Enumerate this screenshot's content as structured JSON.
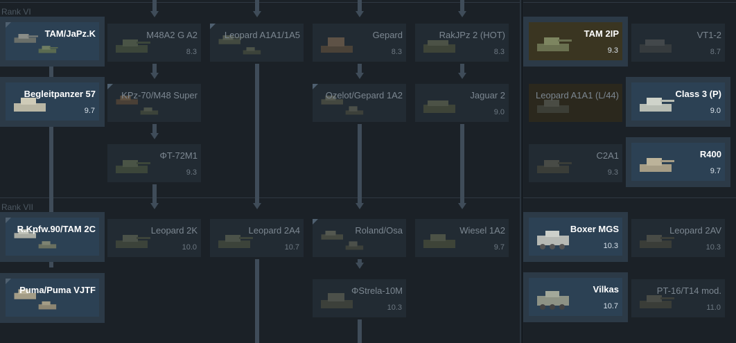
{
  "ranks": {
    "rank6": "Rank VI",
    "rank7": "Rank VII"
  },
  "vehicles": {
    "tam_japz": {
      "name": "TAM/JaPz.K",
      "br": ""
    },
    "m48a2g": {
      "name": "M48A2 G A2",
      "br": "8.3"
    },
    "leopard_a1a1_1a5": {
      "name": "Leopard A1A1/1A5",
      "br": ""
    },
    "gepard": {
      "name": "Gepard",
      "br": "8.3"
    },
    "rakjpz2": {
      "name": "RakJPz 2 (HOT)",
      "br": "8.3"
    },
    "tam2ip": {
      "name": "TAM 2IP",
      "br": "9.3"
    },
    "vt1_2": {
      "name": "VT1-2",
      "br": "8.7"
    },
    "begleitpanzer": {
      "name": "Begleitpanzer 57",
      "br": "9.7"
    },
    "kpz70": {
      "name": "KPz-70/M48 Super",
      "br": ""
    },
    "ozelot": {
      "name": "Ozelot/Gepard 1A2",
      "br": ""
    },
    "jaguar2": {
      "name": "Jaguar 2",
      "br": "9.0"
    },
    "leopard_a1a1_l44": {
      "name": "Leopard A1A1 (L/44)",
      "br": ""
    },
    "class3p": {
      "name": "Class 3 (P)",
      "br": "9.0"
    },
    "t72m1": {
      "name": "ΦT-72M1",
      "br": "9.3"
    },
    "c2a1": {
      "name": "C2A1",
      "br": "9.3"
    },
    "r400": {
      "name": "R400",
      "br": "9.7"
    },
    "rkpfw90": {
      "name": "R.Kpfw.90/TAM 2C",
      "br": ""
    },
    "leopard2k": {
      "name": "Leopard 2K",
      "br": "10.0"
    },
    "leopard2a4": {
      "name": "Leopard 2A4",
      "br": "10.7"
    },
    "roland": {
      "name": "Roland/Osa",
      "br": ""
    },
    "wiesel": {
      "name": "Wiesel 1A2",
      "br": "9.7"
    },
    "boxer": {
      "name": "Boxer MGS",
      "br": "10.3"
    },
    "leopard2av": {
      "name": "Leopard 2AV",
      "br": "10.3"
    },
    "puma": {
      "name": "Puma/Puma VJTF",
      "br": ""
    },
    "strela": {
      "name": "ΦStrela-10M",
      "br": "10.3"
    },
    "vilkas": {
      "name": "Vilkas",
      "br": "10.7"
    },
    "pt16": {
      "name": "PT-16/T14 mod.",
      "br": "11.0"
    }
  },
  "colors": {
    "background": "#1b2127",
    "owned_card": "#2c4154",
    "premium_card": "#3a3521",
    "locked_card": "#222b33",
    "connector": "#3f4c59"
  }
}
